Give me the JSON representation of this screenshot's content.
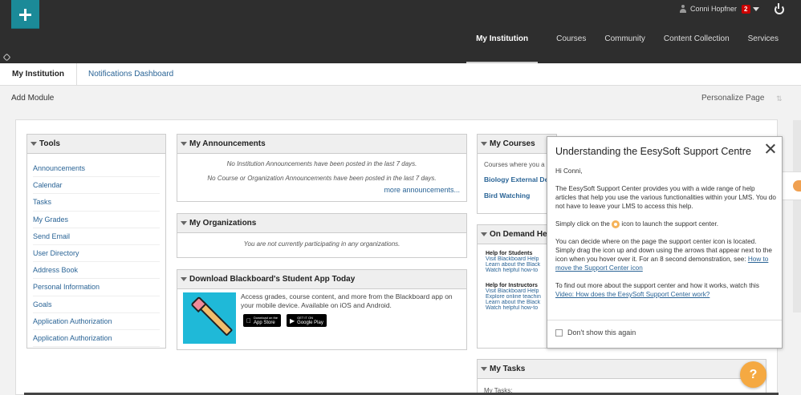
{
  "header": {
    "user_name": "Conni Hopfner",
    "notification_count": "2",
    "nav": [
      "My Institution",
      "Courses",
      "Community",
      "Content Collection",
      "Services"
    ]
  },
  "tabs": [
    "My Institution",
    "Notifications Dashboard"
  ],
  "actions": {
    "add_module": "Add Module",
    "personalize": "Personalize Page",
    "sort_glyph": "⇅"
  },
  "tools": {
    "title": "Tools",
    "items": [
      "Announcements",
      "Calendar",
      "Tasks",
      "My Grades",
      "Send Email",
      "User Directory",
      "Address Book",
      "Personal Information",
      "Goals",
      "Application Authorization",
      "Application Authorization"
    ]
  },
  "announcements": {
    "title": "My Announcements",
    "line1": "No Institution Announcements have been posted in the last 7 days.",
    "line2": "No Course or Organization Announcements have been posted in the last 7 days.",
    "more": "more announcements..."
  },
  "organizations": {
    "title": "My Organizations",
    "message": "You are not currently participating in any organizations."
  },
  "app": {
    "title": "Download Blackboard's Student App Today",
    "text": "Access grades, course content, and more from the Blackboard app on your mobile device. Available on iOS and Android.",
    "appstore": "App Store",
    "googleplay": "Google Play",
    "appstore_small": "Download on the",
    "googleplay_small": "GET IT ON"
  },
  "courses": {
    "title": "My Courses",
    "intro": "Courses where you a",
    "items": [
      "Biology External De",
      "Bird Watching"
    ]
  },
  "ondemand": {
    "title": "On Demand Help",
    "students_h": "Help for Students",
    "students": [
      "Visit Blackboard Help",
      "Learn about the Black",
      "Watch helpful how-to"
    ],
    "instructors_h": "Help for Instructors",
    "instructors": [
      "Visit Blackboard Help",
      "Explore online teachin",
      "Learn about the Black",
      "Watch helpful how-to"
    ]
  },
  "tasks": {
    "title": "My Tasks",
    "label": "My Tasks:"
  },
  "popup": {
    "title": "Understanding the EesySoft Support Centre",
    "greeting": "Hi Conni,",
    "p1": "The EesySoft Support Center provides you with a wide range of help articles that help you use the various functionalities within your LMS. You do not have to leave your LMS to access this help.",
    "p2_a": "Simply click on the",
    "p2_b": "icon to launch the support center.",
    "p3": "You can decide where on the page the support center icon is located. Simply drag the icon up and down using the arrows that appear next to the icon when you hover over it. For an 8 second demonstration, see:",
    "p3_link": "How to move the Support Center icon",
    "p4": "To find out more about the support center and how it works, watch this",
    "p4_link": "Video: How does the EesySoft Support Center work?",
    "dont_show": "Don't show this again"
  },
  "help_fab": "?"
}
